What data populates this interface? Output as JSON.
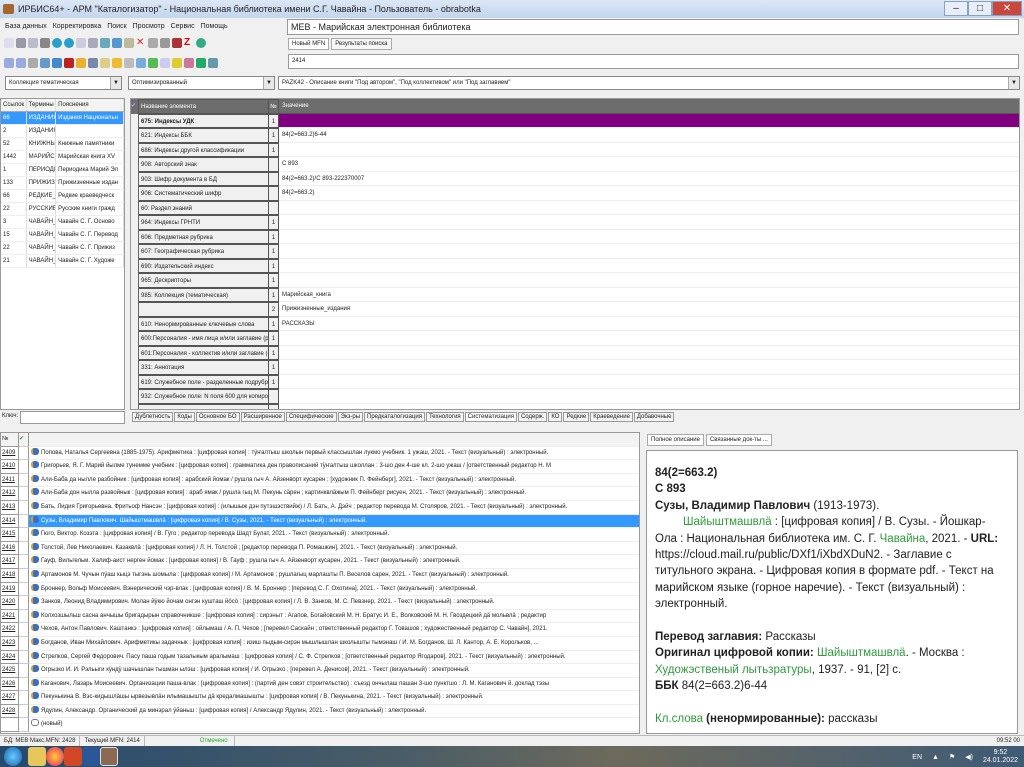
{
  "window": {
    "title": "ИРБИС64+ - АРМ \"Каталогизатор\" - Национальная библиотека имени С.Г. Чавайна - Пользователь - obrabotka",
    "minimize": "–",
    "maximize": "□",
    "close": "✕"
  },
  "menu": [
    "База данных",
    "Корректировка",
    "Поиск",
    "Просмотр",
    "Сервис",
    "Помощь"
  ],
  "database": "МЕВ - Марийская электронная библиотека",
  "mfn_tabs": [
    "Новый MFN",
    "Результаты поиска"
  ],
  "mfn_value": "2414",
  "combos": {
    "dictionary": "Коллекция тематическая",
    "mode": "Оптимизированный",
    "worksheet": "PAZK42 - Описание книги \"Под автором\", \"Под коллективом\" или \"Под заглавием\""
  },
  "terms": {
    "headers": [
      "Ссылок",
      "Термины",
      "Пояснения"
    ],
    "rows": [
      [
        "66",
        "ИЗДАНИЯ",
        "Издания Национальн"
      ],
      [
        "2",
        "ИЗДАНИЯ",
        ""
      ],
      [
        "52",
        "КНИЖНЫЕ",
        "Книжные памятники"
      ],
      [
        "1442",
        "МАРИЙСК",
        "Марийская книга XV"
      ],
      [
        "1",
        "ПЕРИОДИ",
        "Периодика Марий Эл"
      ],
      [
        "133",
        "ПРИЖИЗН",
        "Прижизненные издан"
      ],
      [
        "66",
        "РЕДКИЕ_К",
        "Редкие краеведческ"
      ],
      [
        "22",
        "РУССКИЕ_",
        "Русские книги гражд"
      ],
      [
        "3",
        "ЧАВАЙН_",
        "Чавайн С. Г. Осново"
      ],
      [
        "15",
        "ЧАВАЙН_",
        "Чавайн С. Г. Перевод"
      ],
      [
        "22",
        "ЧАВАЙН_",
        "Чавайн С. Г. Прижиз"
      ],
      [
        "21",
        "ЧАВАЙН_",
        "Чавайн С. Г. Художе"
      ]
    ],
    "key_label": "Ключ:"
  },
  "grid": {
    "headers": [
      "Название элемента",
      "№",
      "Значение"
    ],
    "rows": [
      [
        "675: Индексы УДК",
        "1",
        ""
      ],
      [
        "621: Индексы ББК",
        "1",
        "84(2=663.2)6-44"
      ],
      [
        "686: Индексы другой классификации",
        "1",
        ""
      ],
      [
        "908: Авторский знак",
        "",
        "С 893"
      ],
      [
        "903: Шифр документа в БД",
        "",
        "84(2=663.2)/С 893-222370007"
      ],
      [
        "906: Систематический шифр",
        "",
        "84(2=663.2)"
      ],
      [
        "60: Раздел знаний",
        "",
        ""
      ],
      [
        "964: Индексы ГРНТИ",
        "1",
        ""
      ],
      [
        "606: Предметная рубрика",
        "1",
        ""
      ],
      [
        "607: Географическая рубрика",
        "1",
        ""
      ],
      [
        "690: Издательский индекс",
        "1",
        ""
      ],
      [
        "965: Дескрипторы",
        "1",
        ""
      ],
      [
        "985: Коллекция (тематическая)",
        "1",
        "Марийская_книга"
      ],
      [
        "",
        "2",
        "Прижизненные_издания"
      ],
      [
        "610: Ненормированные ключевые слова",
        "1",
        "РАССКАЗЫ"
      ],
      [
        "600:Персоналия - имя лица и/или заглавие (р",
        "1",
        ""
      ],
      [
        "601:Персоналия - коллектив и/или заглавие (о",
        "1",
        ""
      ],
      [
        "331: Аннотация",
        "1",
        ""
      ],
      [
        "619: Служебное поле - разделенные подрубри",
        "1",
        ""
      ],
      [
        "932: Служебное поле: N поля 600 для копиров",
        "",
        ""
      ],
      [
        "996 МеБН - главная",
        "1",
        ""
      ]
    ],
    "tabs": [
      "Дублетность",
      "Коды",
      "Основное БО",
      "Расширенное",
      "Специфические",
      "Экз-ры",
      "Предкаталогизация",
      "Технология",
      "Систематизация",
      "Содерж.",
      "КО",
      "Редкие",
      "Краеведение",
      "Добавочные"
    ],
    "active_tab": "Систематизация",
    "selected_color": "#800080"
  },
  "list": {
    "header_no": "№",
    "rows": [
      [
        "2409",
        "Попова, Наталья Сергеевна (1885-1975). Арифметика : [цифровая копия] : тÿҥалтыш школын первый классышлан лукмо учебник. 1 ужаш, 2021. - Текст (визуальный) : электронный."
      ],
      [
        "2410",
        "Григорьев, Я. Г. Марий йылме тунемме учебник : [цифровая копия] : грамматика ден правописаний тÿҥалтыш школлан : 3-шо ден 4-ше кл. 2-шо ужаш / [ответственный редактор Н. М"
      ],
      [
        "2411",
        "Али-Баба да нылле разбойник : [цифровая копия] : арабский йомак / рушла гыч А. Айзенворт кусарен ; [художник П. Фейнберг], 2021. - Текст (визуальный) : электронный."
      ],
      [
        "2412",
        "Али-Баба дон нылла развойнык : [цифровая копия] : араб ямак / рушла гыц М. Пекунь сӓрен ; картинквлӓжым П. Фейнберг рисуен, 2021. - Текст (визуальный) : электронный."
      ],
      [
        "2413",
        "Бать, Лидия Григорьевна. Фритьоф Нансэн : [цифровая копия] : (илышыж дэн путэшэствийж) / Л. Бать, А. Дэйч ; редактор перевода М. Столяров, 2021. - Текст (визуальный) : электронный."
      ],
      [
        "2414",
        "Сузы, Владимир Павлович. Шайыштмашвлӓ : [цифровая копия] / В. Сузы, 2021. - Текст (визуальный) : электронный."
      ],
      [
        "2415",
        "Гюго, Виктор. Козэта : [цифровая копия] / В. Гÿго ; редактор перевода Шадт Булат, 2021. - Текст (визуальный) : электронный."
      ],
      [
        "2416",
        "Толстой, Лев Николаевич. Казаквлӓ : [цифровая копия] / Л. Н. Толстой ; [редактор перевода П. Ромашкин], 2021. - Текст (визуальный) : электронный."
      ],
      [
        "2417",
        "Гауф, Вильгельм. Халиф-аист нерген йомак : [цифровая копия] / В. Гауф ; рушла гыч А. Айзенворт кусарен, 2021. - Текст (визуальный) : электронный."
      ],
      [
        "2418",
        "Артамонов М. Чучын пÿаш кыцэ тыгэнь шомыла : [цифровая копия] / М. Артамонов ; рушлагыц марлашты П. Веселов сарен, 2021. - Текст (визуальный) : электронный."
      ],
      [
        "2419",
        "Броннер, Вольф Моисеевич. Вэнерический чэр-влак : [цифровая копия] / В. М. Броннер ; [перевод С. Г. Охотина], 2021. - Текст (визуальный) : электронный."
      ],
      [
        "2420",
        "Занков, Леонид Владимирович. Молан йÿкю йочам онгэн кушташ йӧсӧ : [цифровая копия] / Л. В. Занков, М. С. Певзнер, 2021. - Текст (визуальный) : электронный."
      ],
      [
        "2421",
        "Колхозшыльш сасна анчышы бригадырын справочникше : [цифровая копия] : сирэныт : Агапов, Богайовский М. Н. Братус И. Е., Волковский М. Н. Гвоздецкий дӓ мольвлӓ ; редактир"
      ],
      [
        "2422",
        "Чехов, Антон Павлович. Каштанкэ : [цифровая копия] : ойлымаш / А. П. Чехов ; [перевел Саскайн ; ответственный редактор Г. Товашов ; художественный редактор С. Чавайн], 2021."
      ],
      [
        "2423",
        "Богданов, Иван Михайлович. Арифметикы задачнык : [цифровая копия] : изиш пыдым-сирэн мышлышлан школышты тымэнаш / И. М. Богданов, Ш. Л. Кантор, А. Е. Корольков, ..."
      ],
      [
        "2424",
        "Стрелков, Сергей Федорович. Пасу паша годым тазалыкым аралымаш : [цифровая копия] / С. Ф. Стрелков ; [ответственный редактор Ягодаров], 2021. - Текст (визуальный) : электронный."
      ],
      [
        "2425",
        "Огрызко И. И. Рэльыги кÿндÿ шачышлан тышман ылэш : [цифровая копия] / И. Огрызко ; [перевел А. Денисов], 2021. - Текст (визуальный) : электронный."
      ],
      [
        "2426",
        "Каганович, Лазарь Моисеевич. Организации паша-влак : [цифровая копия] : (партий ден совэт строительство) : съезд ончылаш пашан 3-шо пунктшо : Л. М. Каганович й. доклад тэзы"
      ],
      [
        "2427",
        "Пекунькина В. Вэс-кидышлӓшы ырвезывлӓн илымашышты дӓ кредалмашышты : [цифровая копия] / В. Пекунькина, 2021. - Текст (визуальный) : электронный."
      ],
      [
        "2428",
        "Ядулин, Александр. Органический да минэрал ÿйаньш : [цифровая копия] / Александр Ядулин, 2021. - Текст (визуальный) : электронный."
      ],
      [
        "",
        "(новый)"
      ]
    ],
    "selected": "2414"
  },
  "description": {
    "tabs": [
      "Полное описание",
      "Связанные док-ты ..."
    ],
    "bbk_index": "84(2=663.2)",
    "author_sign": "С 893",
    "author": "Сузы, Владимир Павлович",
    "author_dates": " (1913-1973).",
    "title_link": "Шайыштмашвлӓ",
    "body1": " : [цифровая копия] / В. Сузы. - Йошкар-Ола : Национальная библиотека им. С. Г. ",
    "publisher_link": "Чавайна",
    "body2": ", 2021. - ",
    "url_label": "URL:",
    "body3": " https://cloud.mail.ru/public/DXf1/iXbdXDuN2. - Заглавие с титульного экрана. - Цифровая копия в формате pdf. - Текст на марийском языке (горное наречие). - Текст (визуальный) : электронный.",
    "translation_label": "Перевод заглавия:",
    "translation": " Рассказы",
    "original_label": "Оригинал цифровой копии:",
    "original_link": "Шайыштмашвлӓ",
    "original_body": ". - Москва : ",
    "original_pub": "Художэственый лытьзратуры",
    "original_body2": ", 1937. - 91, [2] с.",
    "bbk_label": "ББК",
    "bbk_value": " 84(2=663.2)6-44",
    "kw_link": "Кл.слова",
    "kw_label": " (ненормированные):",
    "kw_value": " рассказы"
  },
  "status": {
    "db": "БД: МЕВ Макс.MFN: 2428",
    "current": "Текущий MFN: 2414",
    "marked": "Отмечено - 0",
    "time": "09:52 00"
  },
  "taskbar": {
    "lang": "EN",
    "time": "9:52",
    "date": "24.01.2022"
  },
  "colors": {
    "accent": "#3399ff",
    "link_green": "#2e9a3c",
    "purple": "#800080"
  }
}
